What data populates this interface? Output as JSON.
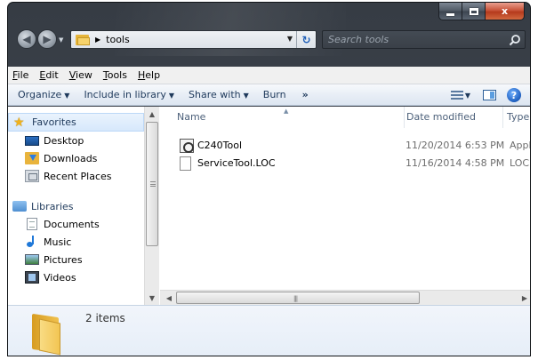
{
  "window": {
    "caption_buttons": {
      "minimize": "minimize",
      "maximize": "maximize",
      "close": "x"
    }
  },
  "navigation": {
    "address_path": "tools",
    "search_placeholder": "Search tools"
  },
  "menubar": {
    "items": [
      {
        "mnemonic": "F",
        "rest": "ile"
      },
      {
        "mnemonic": "E",
        "rest": "dit"
      },
      {
        "mnemonic": "V",
        "rest": "iew"
      },
      {
        "mnemonic": "T",
        "rest": "ools"
      },
      {
        "mnemonic": "H",
        "rest": "elp"
      }
    ]
  },
  "commandbar": {
    "organize": "Organize",
    "include_in_library": "Include in library",
    "share_with": "Share with",
    "burn": "Burn",
    "more": "»"
  },
  "navpane": {
    "favorites": "Favorites",
    "desktop": "Desktop",
    "downloads": "Downloads",
    "recent_places": "Recent Places",
    "libraries": "Libraries",
    "documents": "Documents",
    "music": "Music",
    "pictures": "Pictures",
    "videos": "Videos"
  },
  "files": {
    "columns": {
      "name": "Name",
      "date_modified": "Date modified",
      "type": "Type"
    },
    "rows": [
      {
        "name": "C240Tool",
        "date": "11/20/2014 6:53 PM",
        "type": "Appli",
        "icon": "application-icon"
      },
      {
        "name": "ServiceTool.LOC",
        "date": "11/16/2014 4:58 PM",
        "type": "LOC F",
        "icon": "file-icon"
      }
    ]
  },
  "details": {
    "item_count": "2 items"
  }
}
